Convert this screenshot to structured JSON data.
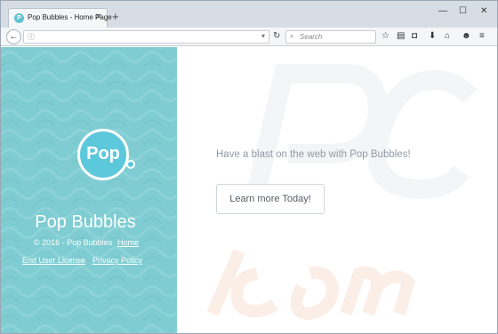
{
  "browser": {
    "tab_title": "Pop Bubbles - Home Page",
    "tab_favicon": "P",
    "tab_close": "✕",
    "new_tab": "+",
    "win_minimize": "—",
    "win_maximize": "☐",
    "win_close": "✕",
    "back": "←",
    "url": "",
    "search_placeholder": "Search",
    "icons": [
      "info-icon",
      "reload-icon",
      "search-icon",
      "star-icon",
      "reading-list-icon",
      "pocket-icon",
      "download-icon",
      "home-icon",
      "chat-icon",
      "menu-icon"
    ]
  },
  "page": {
    "brand_name": "Pop Bubbles",
    "logo_text": "Pop",
    "copyright": "© 2016 - Pop Bubbles",
    "home_link": "Home",
    "eula_link": "End User License",
    "privacy_link": "Privacy Policy",
    "tagline": "Have a blast on the web with Pop Bubbles!",
    "cta_label": "Learn more Today!"
  },
  "colors": {
    "sidebar": "#7fcdd2",
    "logo": "#5cc8db",
    "tagline": "#8f9aa6"
  }
}
